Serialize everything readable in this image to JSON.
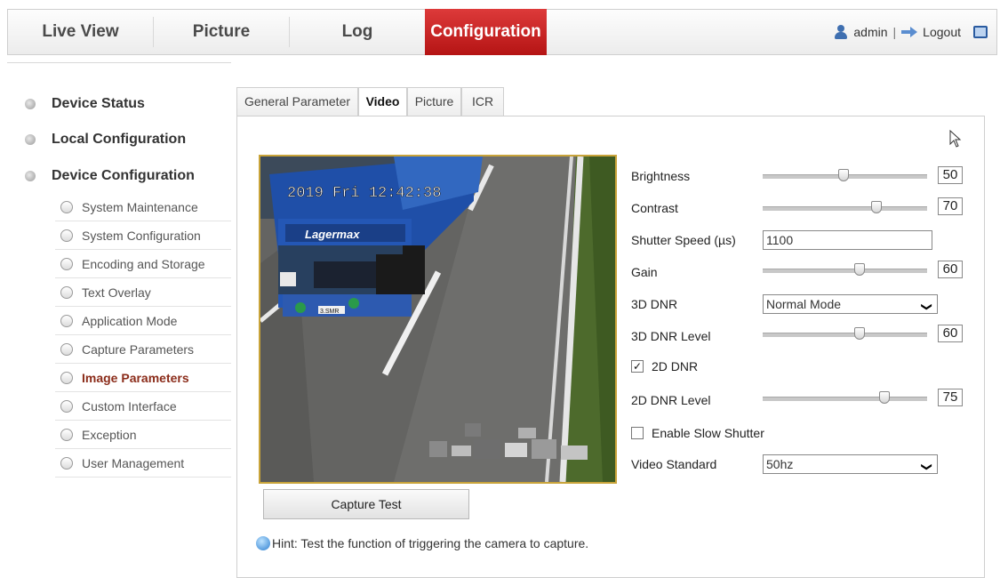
{
  "nav": {
    "tabs": [
      {
        "label": "Live View"
      },
      {
        "label": "Picture"
      },
      {
        "label": "Log"
      },
      {
        "label": "Configuration",
        "active": true
      }
    ],
    "user": "admin",
    "separator": "|",
    "logout": "Logout"
  },
  "sidebar": {
    "groups": [
      {
        "label": "Device Status"
      },
      {
        "label": "Local Configuration"
      },
      {
        "label": "Device Configuration"
      }
    ],
    "items": [
      {
        "label": "System Maintenance"
      },
      {
        "label": "System Configuration"
      },
      {
        "label": "Encoding and Storage"
      },
      {
        "label": "Text Overlay"
      },
      {
        "label": "Application Mode"
      },
      {
        "label": "Capture Parameters"
      },
      {
        "label": "Image Parameters",
        "active": true
      },
      {
        "label": "Custom Interface"
      },
      {
        "label": "Exception"
      },
      {
        "label": "User Management"
      }
    ]
  },
  "content_tabs": [
    {
      "label": "General Parameter"
    },
    {
      "label": "Video",
      "active": true
    },
    {
      "label": "Picture"
    },
    {
      "label": "ICR"
    }
  ],
  "video": {
    "osd_text": "2019 Fri 12:42:38",
    "truck_brand": "Lagermax",
    "plate": "3.SMR"
  },
  "capture_button": "Capture Test",
  "hint": "Hint: Test the function of triggering the camera to capture.",
  "params": {
    "brightness": {
      "label": "Brightness",
      "value": "50"
    },
    "contrast": {
      "label": "Contrast",
      "value": "70"
    },
    "shutter": {
      "label": "Shutter Speed (µs)",
      "value": "1100"
    },
    "gain": {
      "label": "Gain",
      "value": "60"
    },
    "dnr3d": {
      "label": "3D DNR",
      "value": "Normal Mode"
    },
    "dnr3d_level": {
      "label": "3D DNR Level",
      "value": "60"
    },
    "dnr2d": {
      "label": "2D DNR",
      "checked": true
    },
    "dnr2d_level": {
      "label": "2D DNR Level",
      "value": "75"
    },
    "slow_shutter": {
      "label": "Enable Slow Shutter",
      "checked": false
    },
    "video_standard": {
      "label": "Video Standard",
      "value": "50hz"
    }
  },
  "slider_levels": {
    "brightness": 0.49,
    "contrast": 0.69,
    "gain": 0.59,
    "dnr3d_level": 0.59,
    "dnr2d_level": 0.74
  },
  "colors": {
    "active_nav": "#c81c1c",
    "active_sidebar_text": "#8b2c1a",
    "video_border": "#c9a43a"
  }
}
